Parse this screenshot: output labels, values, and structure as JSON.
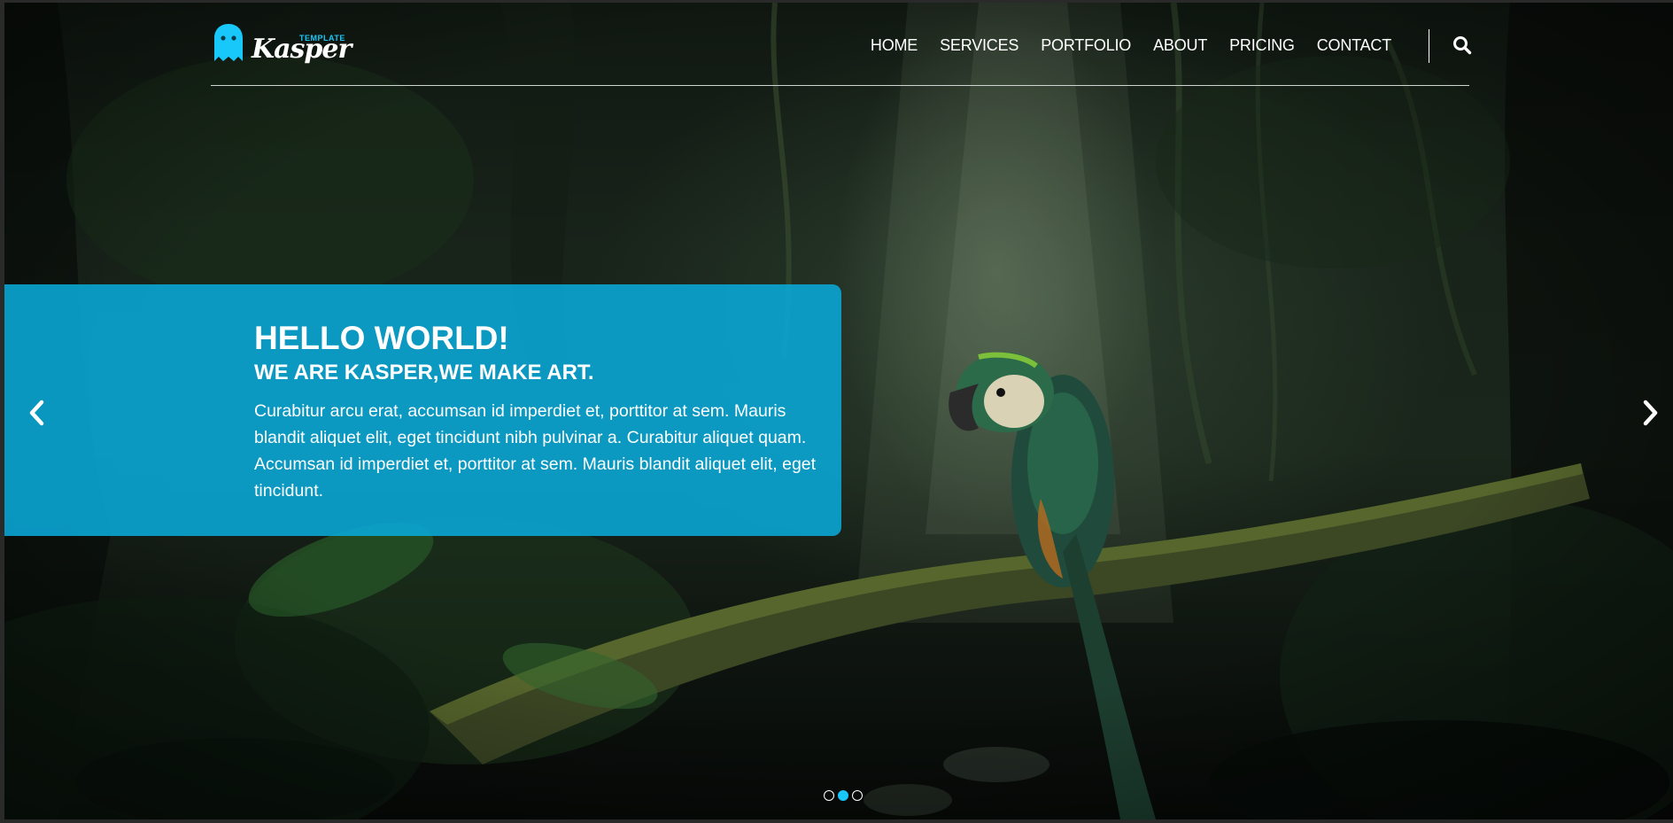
{
  "brand": {
    "name": "Kasper",
    "tag": "TEMPLATE",
    "accent": "#19c8fa"
  },
  "nav": {
    "items": [
      {
        "label": "HOME"
      },
      {
        "label": "SERVICES"
      },
      {
        "label": "PORTFOLIO"
      },
      {
        "label": "ABOUT"
      },
      {
        "label": "PRICING"
      },
      {
        "label": "CONTACT"
      }
    ],
    "search_icon": "search-icon"
  },
  "slider": {
    "title": "HELLO WORLD!",
    "subtitle": "WE ARE KASPER,WE MAKE ART.",
    "text": "Curabitur arcu erat, accumsan id imperdiet et, porttitor at sem. Mauris blandit aliquet elit, eget tincidunt nibh pulvinar a. Curabitur aliquet quam. Accumsan id imperdiet et, porttitor at sem. Mauris blandit aliquet elit, eget tincidunt.",
    "card_color": "#09a8d8",
    "prev_icon": "chevron-left-icon",
    "next_icon": "chevron-right-icon",
    "bullets": [
      {
        "active": false
      },
      {
        "active": true
      },
      {
        "active": false
      }
    ]
  },
  "background": {
    "image": "jungle-parrot-photo"
  }
}
